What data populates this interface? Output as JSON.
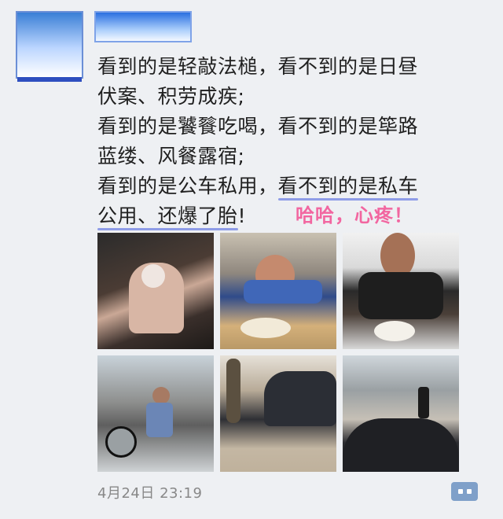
{
  "post": {
    "lines": [
      "看到的是轻敲法槌，看不到的是日昼",
      "伏案、积劳成疾;",
      "看到的是饕餮吃喝，看不到的是筚路",
      "蓝缕、风餐露宿;"
    ],
    "line5_a": "看到的是公车私用，",
    "line5_b": "看不到的是私车",
    "line6_a": "公用、还爆了胎",
    "line6_b": "!",
    "annotation": "哈哈，心疼！",
    "timestamp": "4月24日 23:19"
  },
  "photos": [
    {
      "name": "photo-person-sleeping-chair"
    },
    {
      "name": "photo-man-eating"
    },
    {
      "name": "photo-man-eating-noodles"
    },
    {
      "name": "photo-motorbike-street"
    },
    {
      "name": "photo-car-flat-tire"
    },
    {
      "name": "photo-car-roadside"
    }
  ],
  "colors": {
    "underline": "#8e9ce7",
    "annotation": "#f266a0",
    "more_button": "#7fa0c9"
  }
}
